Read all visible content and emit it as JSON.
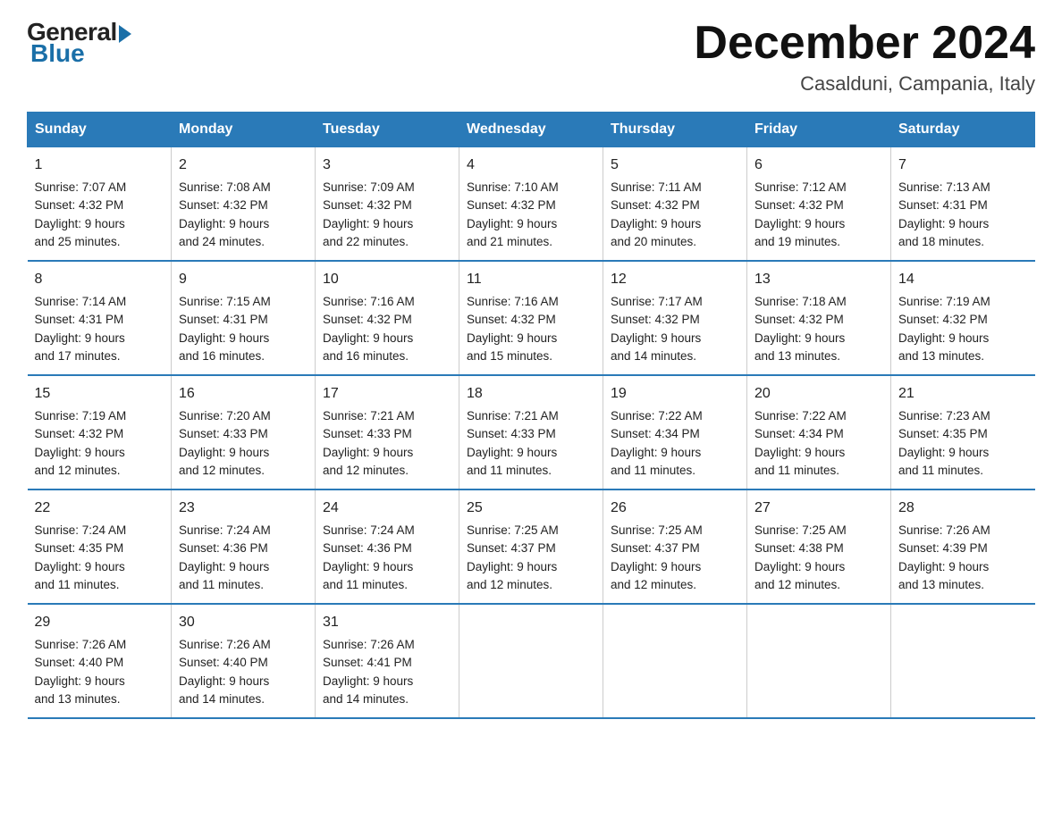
{
  "logo": {
    "general": "General",
    "blue": "Blue"
  },
  "title": "December 2024",
  "location": "Casalduni, Campania, Italy",
  "days_of_week": [
    "Sunday",
    "Monday",
    "Tuesday",
    "Wednesday",
    "Thursday",
    "Friday",
    "Saturday"
  ],
  "weeks": [
    [
      {
        "day": "1",
        "sunrise": "7:07 AM",
        "sunset": "4:32 PM",
        "daylight": "9 hours and 25 minutes."
      },
      {
        "day": "2",
        "sunrise": "7:08 AM",
        "sunset": "4:32 PM",
        "daylight": "9 hours and 24 minutes."
      },
      {
        "day": "3",
        "sunrise": "7:09 AM",
        "sunset": "4:32 PM",
        "daylight": "9 hours and 22 minutes."
      },
      {
        "day": "4",
        "sunrise": "7:10 AM",
        "sunset": "4:32 PM",
        "daylight": "9 hours and 21 minutes."
      },
      {
        "day": "5",
        "sunrise": "7:11 AM",
        "sunset": "4:32 PM",
        "daylight": "9 hours and 20 minutes."
      },
      {
        "day": "6",
        "sunrise": "7:12 AM",
        "sunset": "4:32 PM",
        "daylight": "9 hours and 19 minutes."
      },
      {
        "day": "7",
        "sunrise": "7:13 AM",
        "sunset": "4:31 PM",
        "daylight": "9 hours and 18 minutes."
      }
    ],
    [
      {
        "day": "8",
        "sunrise": "7:14 AM",
        "sunset": "4:31 PM",
        "daylight": "9 hours and 17 minutes."
      },
      {
        "day": "9",
        "sunrise": "7:15 AM",
        "sunset": "4:31 PM",
        "daylight": "9 hours and 16 minutes."
      },
      {
        "day": "10",
        "sunrise": "7:16 AM",
        "sunset": "4:32 PM",
        "daylight": "9 hours and 16 minutes."
      },
      {
        "day": "11",
        "sunrise": "7:16 AM",
        "sunset": "4:32 PM",
        "daylight": "9 hours and 15 minutes."
      },
      {
        "day": "12",
        "sunrise": "7:17 AM",
        "sunset": "4:32 PM",
        "daylight": "9 hours and 14 minutes."
      },
      {
        "day": "13",
        "sunrise": "7:18 AM",
        "sunset": "4:32 PM",
        "daylight": "9 hours and 13 minutes."
      },
      {
        "day": "14",
        "sunrise": "7:19 AM",
        "sunset": "4:32 PM",
        "daylight": "9 hours and 13 minutes."
      }
    ],
    [
      {
        "day": "15",
        "sunrise": "7:19 AM",
        "sunset": "4:32 PM",
        "daylight": "9 hours and 12 minutes."
      },
      {
        "day": "16",
        "sunrise": "7:20 AM",
        "sunset": "4:33 PM",
        "daylight": "9 hours and 12 minutes."
      },
      {
        "day": "17",
        "sunrise": "7:21 AM",
        "sunset": "4:33 PM",
        "daylight": "9 hours and 12 minutes."
      },
      {
        "day": "18",
        "sunrise": "7:21 AM",
        "sunset": "4:33 PM",
        "daylight": "9 hours and 11 minutes."
      },
      {
        "day": "19",
        "sunrise": "7:22 AM",
        "sunset": "4:34 PM",
        "daylight": "9 hours and 11 minutes."
      },
      {
        "day": "20",
        "sunrise": "7:22 AM",
        "sunset": "4:34 PM",
        "daylight": "9 hours and 11 minutes."
      },
      {
        "day": "21",
        "sunrise": "7:23 AM",
        "sunset": "4:35 PM",
        "daylight": "9 hours and 11 minutes."
      }
    ],
    [
      {
        "day": "22",
        "sunrise": "7:24 AM",
        "sunset": "4:35 PM",
        "daylight": "9 hours and 11 minutes."
      },
      {
        "day": "23",
        "sunrise": "7:24 AM",
        "sunset": "4:36 PM",
        "daylight": "9 hours and 11 minutes."
      },
      {
        "day": "24",
        "sunrise": "7:24 AM",
        "sunset": "4:36 PM",
        "daylight": "9 hours and 11 minutes."
      },
      {
        "day": "25",
        "sunrise": "7:25 AM",
        "sunset": "4:37 PM",
        "daylight": "9 hours and 12 minutes."
      },
      {
        "day": "26",
        "sunrise": "7:25 AM",
        "sunset": "4:37 PM",
        "daylight": "9 hours and 12 minutes."
      },
      {
        "day": "27",
        "sunrise": "7:25 AM",
        "sunset": "4:38 PM",
        "daylight": "9 hours and 12 minutes."
      },
      {
        "day": "28",
        "sunrise": "7:26 AM",
        "sunset": "4:39 PM",
        "daylight": "9 hours and 13 minutes."
      }
    ],
    [
      {
        "day": "29",
        "sunrise": "7:26 AM",
        "sunset": "4:40 PM",
        "daylight": "9 hours and 13 minutes."
      },
      {
        "day": "30",
        "sunrise": "7:26 AM",
        "sunset": "4:40 PM",
        "daylight": "9 hours and 14 minutes."
      },
      {
        "day": "31",
        "sunrise": "7:26 AM",
        "sunset": "4:41 PM",
        "daylight": "9 hours and 14 minutes."
      },
      null,
      null,
      null,
      null
    ]
  ]
}
